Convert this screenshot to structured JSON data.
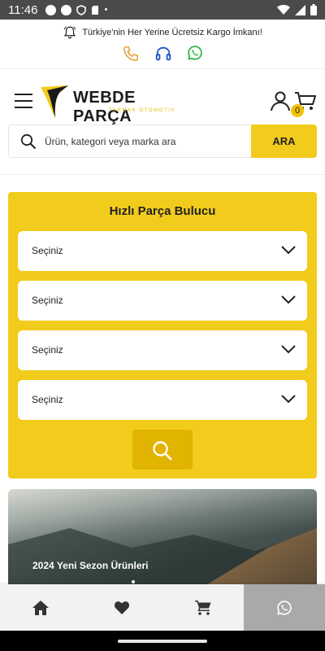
{
  "status_bar": {
    "time": "11:46",
    "dot": "•"
  },
  "top_info": {
    "shipping_text": "Türkiye'nin Her Yerine Ücretsiz Kargo İmkanı!",
    "contacts": [
      {
        "icon": "phone-icon",
        "color": "#e8a03a"
      },
      {
        "icon": "headset-icon",
        "color": "#1a56c9"
      },
      {
        "icon": "whatsapp-icon",
        "color": "#25b33f"
      }
    ]
  },
  "header": {
    "logo": {
      "brand": "WEBDE PARÇA",
      "sub": "TARMAK OTOMOTİV"
    },
    "cart_count": "0"
  },
  "search": {
    "placeholder": "Ürün, kategori veya marka ara",
    "button_label": "ARA"
  },
  "finder": {
    "title": "Hızlı Parça Bulucu",
    "selects": [
      "Seçiniz",
      "Seçiniz",
      "Seçiniz",
      "Seçiniz"
    ]
  },
  "banner": {
    "caption": "2024 Yeni Sezon Ürünleri"
  },
  "bottom_nav": {
    "items": [
      {
        "icon": "home-icon"
      },
      {
        "icon": "heart-icon"
      },
      {
        "icon": "cart-icon"
      },
      {
        "icon": "whatsapp-icon",
        "active": true
      }
    ]
  },
  "colors": {
    "accent": "#f2cc1c",
    "accent_dark": "#e0b400",
    "status_bar": "#4a4a4a"
  }
}
